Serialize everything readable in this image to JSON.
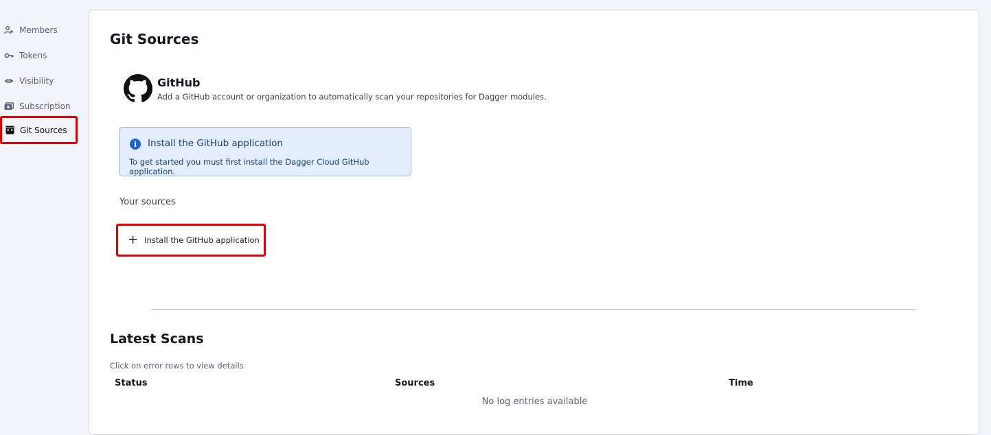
{
  "sidebar": {
    "items": [
      {
        "label": "Members",
        "icon": "members-icon"
      },
      {
        "label": "Tokens",
        "icon": "key-icon"
      },
      {
        "label": "Visibility",
        "icon": "eye-icon"
      },
      {
        "label": "Subscription",
        "icon": "subscription-icon"
      },
      {
        "label": "Git Sources",
        "icon": "git-sources-icon",
        "active": true
      }
    ]
  },
  "main": {
    "title": "Git Sources",
    "provider": {
      "name": "GitHub",
      "description": "Add a GitHub account or organization to automatically scan your repositories for Dagger modules."
    },
    "alert": {
      "title": "Install the GitHub application",
      "text": "To get started you must first install the Dagger Cloud GitHub application."
    },
    "sources_label": "Your sources",
    "install_button_label": "Install the GitHub application",
    "scans": {
      "title": "Latest Scans",
      "hint": "Click on error rows to view details",
      "columns": [
        "Status",
        "Sources",
        "Time"
      ],
      "empty_message": "No log entries available"
    }
  },
  "colors": {
    "highlight": "#e50000",
    "info_bg": "#e3edfd",
    "info_accent": "#1565d8"
  }
}
